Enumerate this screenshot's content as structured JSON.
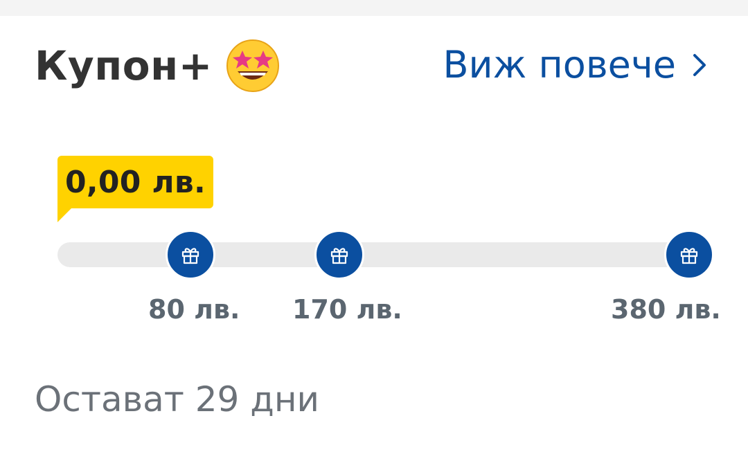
{
  "card": {
    "title": "Купон+",
    "title_emoji": "star-struck-emoji",
    "see_more_label": "Виж повече",
    "see_more_icon": "chevron-right-icon"
  },
  "progress": {
    "current_amount": "0,00 лв.",
    "current_value": 0,
    "max_value": 380,
    "milestones": [
      {
        "label": "80 лв.",
        "value": 80,
        "icon": "gift-icon"
      },
      {
        "label": "170 лв.",
        "value": 170,
        "icon": "gift-icon"
      },
      {
        "label": "380 лв.",
        "value": 380,
        "icon": "gift-icon"
      }
    ]
  },
  "footer": {
    "remaining_text": "Остават 29 дни"
  },
  "colors": {
    "accent_blue": "#0b4fa0",
    "badge_yellow": "#ffd200",
    "track_gray": "#eaeaea",
    "title_text": "#333333",
    "muted_text": "#6b7178"
  }
}
